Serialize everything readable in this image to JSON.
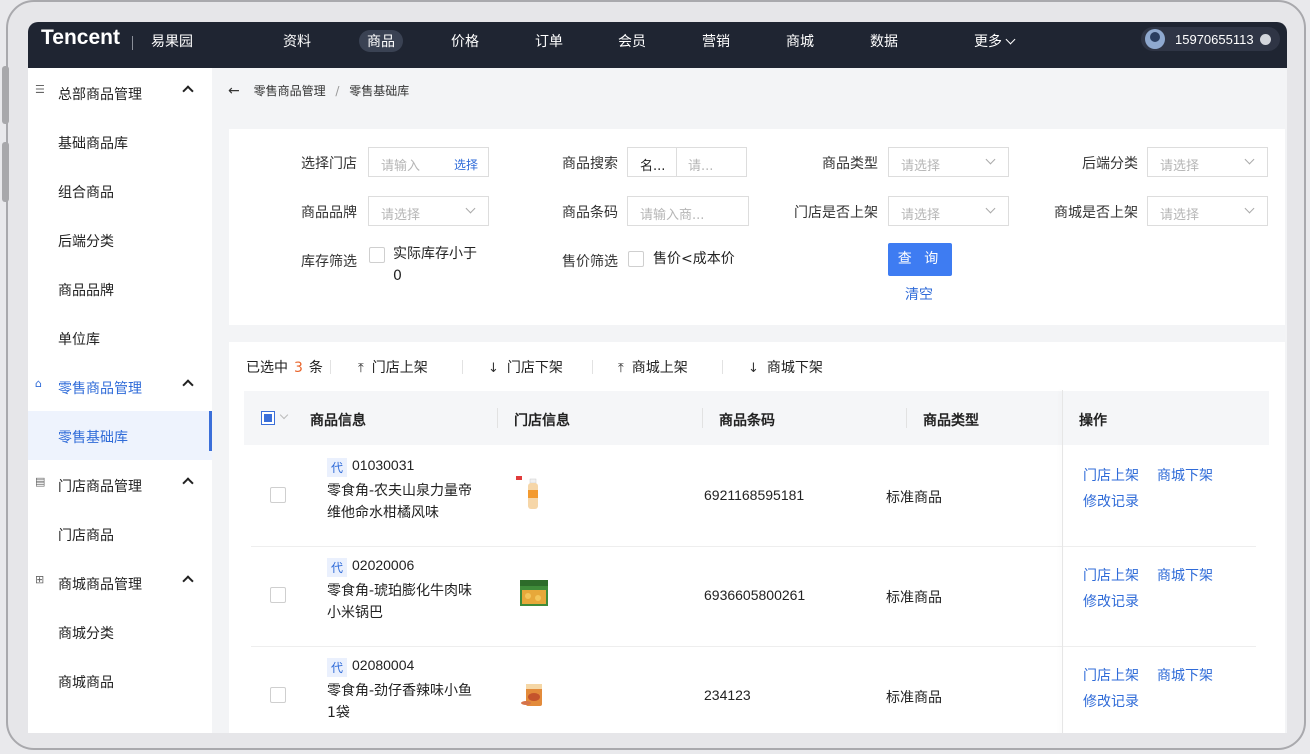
{
  "header": {
    "logo": "Tencent",
    "store": "易果园",
    "nav": [
      "资料",
      "商品",
      "价格",
      "订单",
      "会员",
      "营销",
      "商城",
      "数据",
      "更多"
    ],
    "active_nav": "商品",
    "user_phone": "15970655113"
  },
  "sidebar": {
    "items": [
      {
        "label": "总部商品管理",
        "type": "group",
        "icon": "list-icon"
      },
      {
        "label": "基础商品库",
        "type": "sub"
      },
      {
        "label": "组合商品",
        "type": "sub"
      },
      {
        "label": "后端分类",
        "type": "sub"
      },
      {
        "label": "商品品牌",
        "type": "sub"
      },
      {
        "label": "单位库",
        "type": "sub"
      },
      {
        "label": "零售商品管理",
        "type": "group",
        "icon": "bag-icon"
      },
      {
        "label": "零售基础库",
        "type": "sub",
        "active": true
      },
      {
        "label": "门店商品管理",
        "type": "group",
        "icon": "store-icon"
      },
      {
        "label": "门店商品",
        "type": "sub"
      },
      {
        "label": "商城商品管理",
        "type": "group",
        "icon": "grid-icon"
      },
      {
        "label": "商城分类",
        "type": "sub"
      },
      {
        "label": "商城商品",
        "type": "sub"
      }
    ]
  },
  "breadcrumb": {
    "parent": "零售商品管理",
    "current": "零售基础库"
  },
  "filters": {
    "store_label": "选择门店",
    "store_placeholder": "请输入",
    "store_select": "选择",
    "search_label": "商品搜索",
    "search_mode": "名...",
    "search_placeholder": "请...",
    "type_label": "商品类型",
    "type_placeholder": "请选择",
    "category_label": "后端分类",
    "category_placeholder": "请选择",
    "brand_label": "商品品牌",
    "brand_placeholder": "请选择",
    "barcode_label": "商品条码",
    "barcode_placeholder": "请输入商...",
    "store_listed_label": "门店是否上架",
    "store_listed_placeholder": "请选择",
    "mall_listed_label": "商城是否上架",
    "mall_listed_placeholder": "请选择",
    "stock_label": "库存筛选",
    "stock_option_line1": "实际库存小于",
    "stock_option_line2": "0",
    "price_label": "售价筛选",
    "price_option": "售价<成本价",
    "query_button": "查 询",
    "clear_link": "清空"
  },
  "toolbar": {
    "selected_prefix": "已选中",
    "selected_count": "3",
    "selected_suffix": "条",
    "actions": [
      "门店上架",
      "门店下架",
      "商城上架",
      "商城下架"
    ]
  },
  "table": {
    "columns": [
      "商品信息",
      "门店信息",
      "商品条码",
      "商品类型",
      "操作"
    ],
    "rows": [
      {
        "tag": "代",
        "code": "01030031",
        "name": "零食角-农夫山泉力量帝维他命水柑橘风味",
        "barcode": "6921168595181",
        "type": "标准商品",
        "actions": [
          "门店上架",
          "商城下架",
          "修改记录"
        ]
      },
      {
        "tag": "代",
        "code": "02020006",
        "name": "零食角-琥珀膨化牛肉味小米锅巴",
        "barcode": "6936605800261",
        "type": "标准商品",
        "actions": [
          "门店上架",
          "商城下架",
          "修改记录"
        ]
      },
      {
        "tag": "代",
        "code": "02080004",
        "name": "零食角-劲仔香辣味小鱼1袋",
        "barcode": "234123",
        "type": "标准商品",
        "actions": [
          "门店上架",
          "商城下架",
          "修改记录"
        ]
      }
    ]
  }
}
